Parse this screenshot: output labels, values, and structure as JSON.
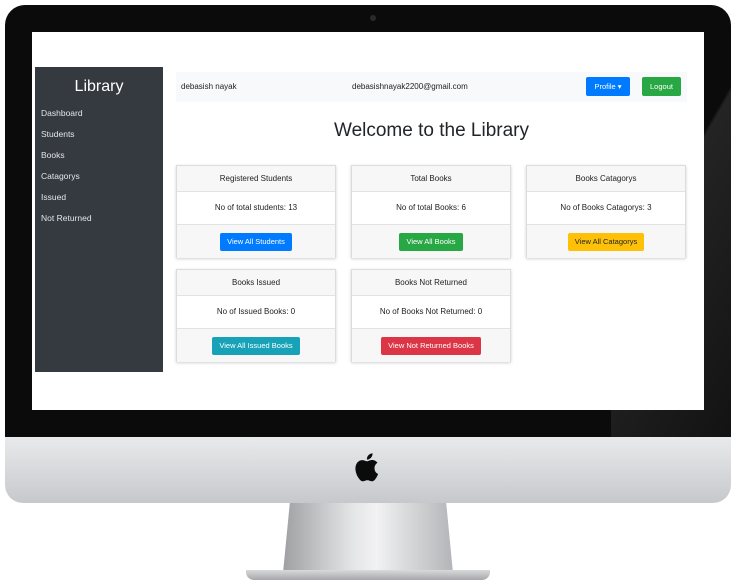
{
  "sidebar": {
    "title": "Library",
    "items": [
      {
        "label": "Dashboard"
      },
      {
        "label": "Students"
      },
      {
        "label": "Books"
      },
      {
        "label": "Catagorys"
      },
      {
        "label": "Issued"
      },
      {
        "label": "Not Returned"
      }
    ]
  },
  "topbar": {
    "user_name": "debasish nayak",
    "user_email": "debasishnayak2200@gmail.com",
    "profile_label": "Profile",
    "logout_label": "Logout"
  },
  "welcome": "Welcome to the Library",
  "cards": [
    {
      "title": "Registered Students",
      "text": "No of total students: 13",
      "button": "View All Students",
      "color": "#007bff"
    },
    {
      "title": "Total Books",
      "text": "No of total Books: 6",
      "button": "View All Books",
      "color": "#28a745"
    },
    {
      "title": "Books Catagorys",
      "text": "No of Books Catagorys: 3",
      "button": "View All Catagorys",
      "color": "#ffc107"
    },
    {
      "title": "Books Issued",
      "text": "No of Issued Books: 0",
      "button": "View All Issued Books",
      "color": "#17a2b8"
    },
    {
      "title": "Books Not Returned",
      "text": "No of Books Not Returned: 0",
      "button": "View Not Returned Books",
      "color": "#dc3545"
    }
  ],
  "icons": {
    "profile_caret": "caret-down-icon",
    "device_logo": "apple-logo-icon"
  }
}
